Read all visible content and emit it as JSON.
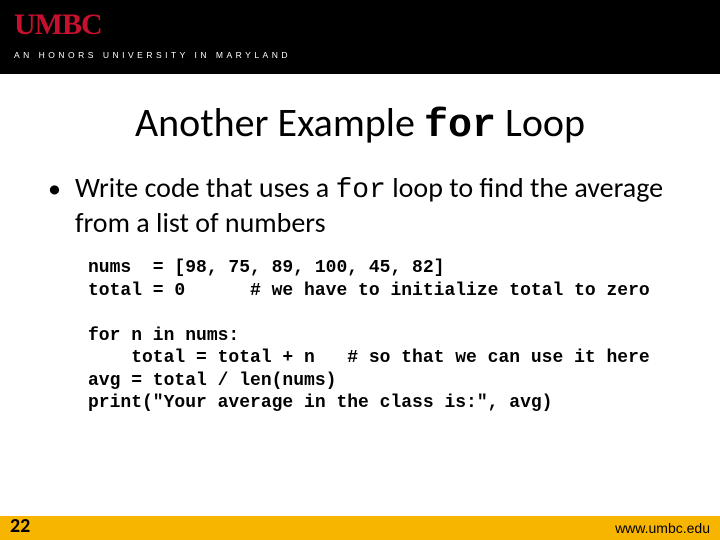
{
  "header": {
    "logo": "UMBC",
    "tagline": "AN HONORS UNIVERSITY IN MARYLAND"
  },
  "title": {
    "pre": "Another Example ",
    "mono": "for",
    "post": " Loop"
  },
  "bullet": {
    "pre": "Write code that uses a ",
    "mono": "for",
    "post": " loop to find the average from a list of numbers"
  },
  "code": {
    "line1": "nums  = [98, 75, 89, 100, 45, 82]",
    "line2": "total = 0      # we have to initialize total to zero",
    "blank1": "",
    "line3": "for n in nums:",
    "line4": "    total = total + n   # so that we can use it here",
    "line5": "avg = total / len(nums)",
    "line6": "print(\"Your average in the class is:\", avg)"
  },
  "footer": {
    "page": "22",
    "url": "www.umbc.edu"
  }
}
